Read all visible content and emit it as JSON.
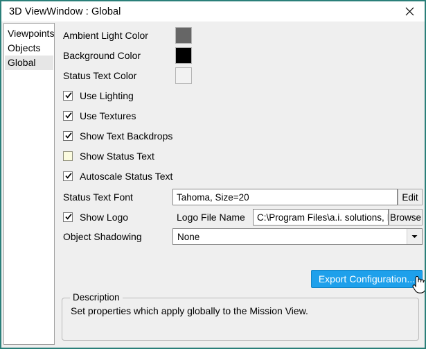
{
  "window": {
    "title": "3D ViewWindow : Global",
    "close_icon": "close-icon",
    "border_color": "#2a7f79"
  },
  "sidebar": {
    "items": [
      {
        "label": "Viewpoints",
        "selected": false
      },
      {
        "label": "Objects",
        "selected": false
      },
      {
        "label": "Global",
        "selected": true
      }
    ]
  },
  "settings": {
    "color_rows": [
      {
        "label": "Ambient Light Color",
        "color": "#666666"
      },
      {
        "label": "Background Color",
        "color": "#000000"
      },
      {
        "label": "Status Text Color",
        "color": "#f2f2f2"
      }
    ],
    "checkboxes": [
      {
        "label": "Use Lighting",
        "checked": true
      },
      {
        "label": "Use Textures",
        "checked": true
      },
      {
        "label": "Show Text Backdrops",
        "checked": true
      },
      {
        "label": "Show Status Text",
        "checked": false
      },
      {
        "label": "Autoscale Status Text",
        "checked": true
      }
    ],
    "status_text_font": {
      "label": "Status Text Font",
      "value": "Tahoma, Size=20",
      "edit_label": "Edit"
    },
    "show_logo": {
      "label": "Show Logo",
      "checked": true
    },
    "logo_file": {
      "label": "Logo File Name",
      "value": "C:\\Program Files\\a.i. solutions, Inc",
      "browse_label": "Browse"
    },
    "object_shadowing": {
      "label": "Object Shadowing",
      "value": "None",
      "dropdown_icon": "chevron-down-icon"
    }
  },
  "actions": {
    "export_label": "Export Configuration...",
    "export_color": "#1ea0eb"
  },
  "description": {
    "legend": "Description",
    "text": "Set properties which apply globally to the Mission View."
  },
  "cursor": {
    "icon": "hand-pointer-cursor"
  }
}
